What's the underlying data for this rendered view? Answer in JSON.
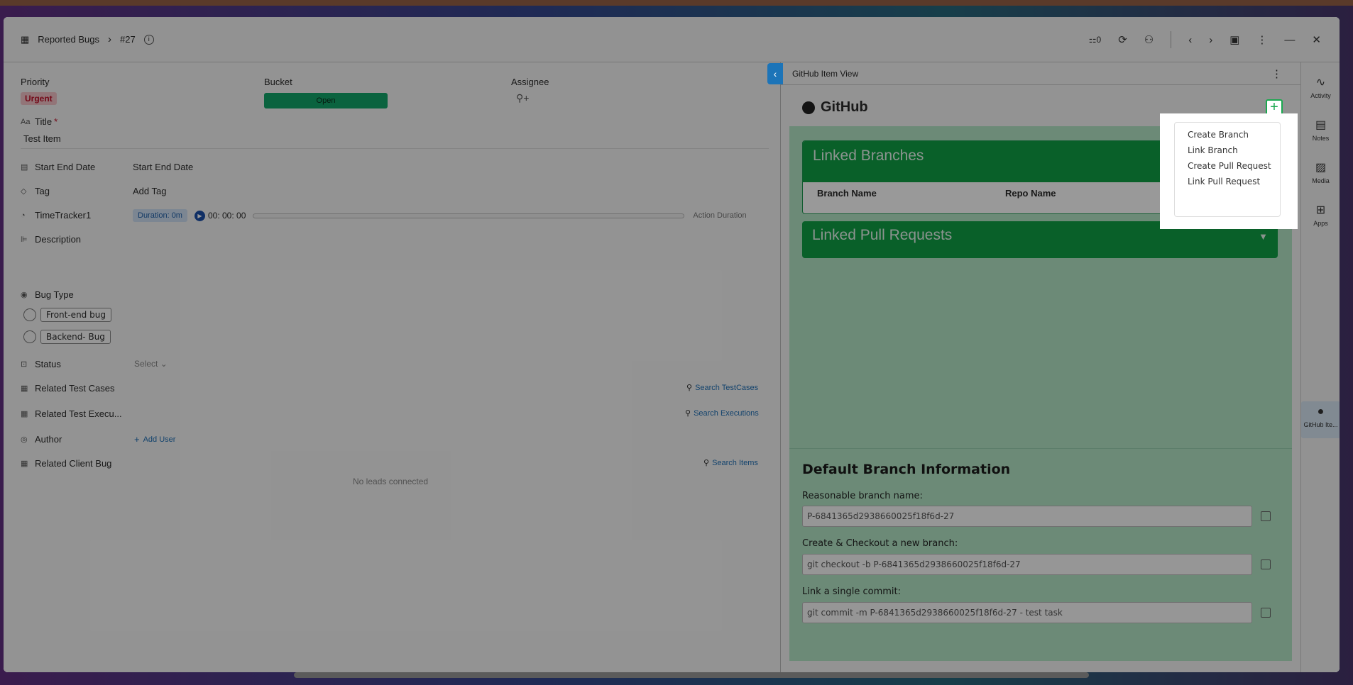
{
  "header": {
    "breadcrumb_root": "Reported Bugs",
    "breadcrumb_item": "#27",
    "subtask_count": "0"
  },
  "fields": {
    "priority_label": "Priority",
    "priority_value": "Urgent",
    "bucket_label": "Bucket",
    "bucket_value": "Open",
    "assignee_label": "Assignee",
    "title_label": "Title",
    "title_required": "*",
    "title_value": "Test Item",
    "start_end_label": "Start End Date",
    "start_end_value": "Start End Date",
    "tag_label": "Tag",
    "tag_value": "Add Tag",
    "timetracker_label": "TimeTracker1",
    "duration_badge": "Duration: 0m",
    "timer_value": "00: 00: 00",
    "action_duration": "Action Duration",
    "description_label": "Description",
    "bug_type_label": "Bug Type",
    "bug_type_options": [
      "Front-end bug",
      "Backend- Bug"
    ],
    "status_label": "Status",
    "status_value": "Select",
    "related_test_cases_label": "Related Test Cases",
    "search_testcases": "Search TestCases",
    "related_test_exec_label": "Related Test Execu...",
    "search_executions": "Search Executions",
    "author_label": "Author",
    "add_user": "Add User",
    "related_client_bug_label": "Related Client Bug",
    "search_items": "Search Items",
    "no_leads": "No leads connected"
  },
  "right_panel": {
    "title": "GitHub Item View",
    "github_heading": "GitHub",
    "linked_branches": "Linked Branches",
    "col_branch_name": "Branch Name",
    "col_repo_name": "Repo Name",
    "linked_pull_requests": "Linked Pull Requests",
    "default_branch_heading": "Default Branch Information",
    "reasonable_label": "Reasonable branch name:",
    "reasonable_value": "P-6841365d2938660025f18f6d-27",
    "checkout_label": "Create & Checkout a new branch:",
    "checkout_value": "git checkout -b P-6841365d2938660025f18f6d-27",
    "commit_label": "Link a single commit:",
    "commit_value": "git commit -m P-6841365d2938660025f18f6d-27 - test task"
  },
  "dropdown_menu": [
    "Create Branch",
    "Link Branch",
    "Create Pull Request",
    "Link Pull Request"
  ],
  "rail": {
    "activity": "Activity",
    "notes": "Notes",
    "media": "Media",
    "apps": "Apps",
    "github": "GitHub Ite..."
  },
  "colors": {
    "urgent": "#c0122a",
    "open_bucket": "#12a66a",
    "github_green": "#0fa045",
    "accent_blue": "#1c74b8"
  }
}
